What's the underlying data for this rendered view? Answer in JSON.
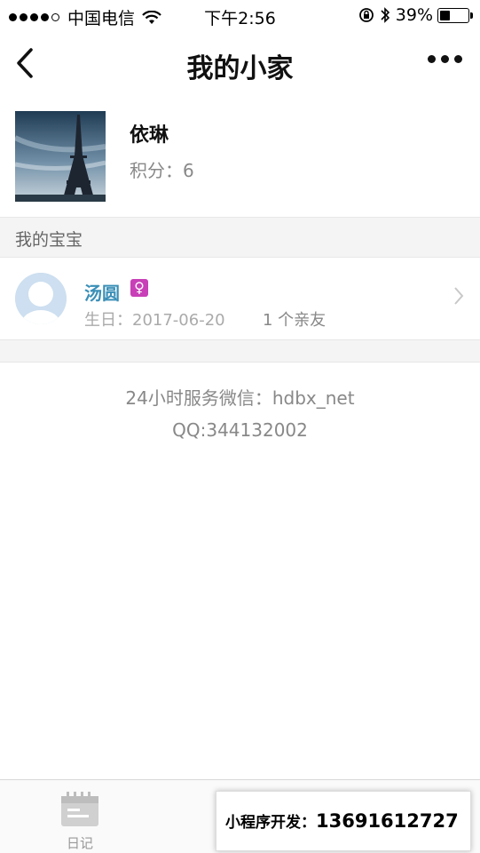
{
  "status_bar": {
    "carrier": "中国电信",
    "time": "下午2:56",
    "battery": "39%",
    "battery_level": 0.39
  },
  "nav": {
    "title": "我的小家"
  },
  "profile": {
    "name": "依琳",
    "points_label": "积分：",
    "points": "6"
  },
  "section_title": "我的宝宝",
  "baby": {
    "name": "汤圆",
    "gender_icon": "female-icon",
    "birthday_label": "生日：",
    "birthday": "2017-06-20",
    "friends": "1 个亲友"
  },
  "service": {
    "wechat": "24小时服务微信：hdbx_net",
    "qq": "QQ:344132002"
  },
  "tabs": [
    {
      "label": "日记",
      "icon": "diary-icon"
    }
  ],
  "promo": {
    "label": "小程序开发：",
    "phone": "13691612727"
  }
}
